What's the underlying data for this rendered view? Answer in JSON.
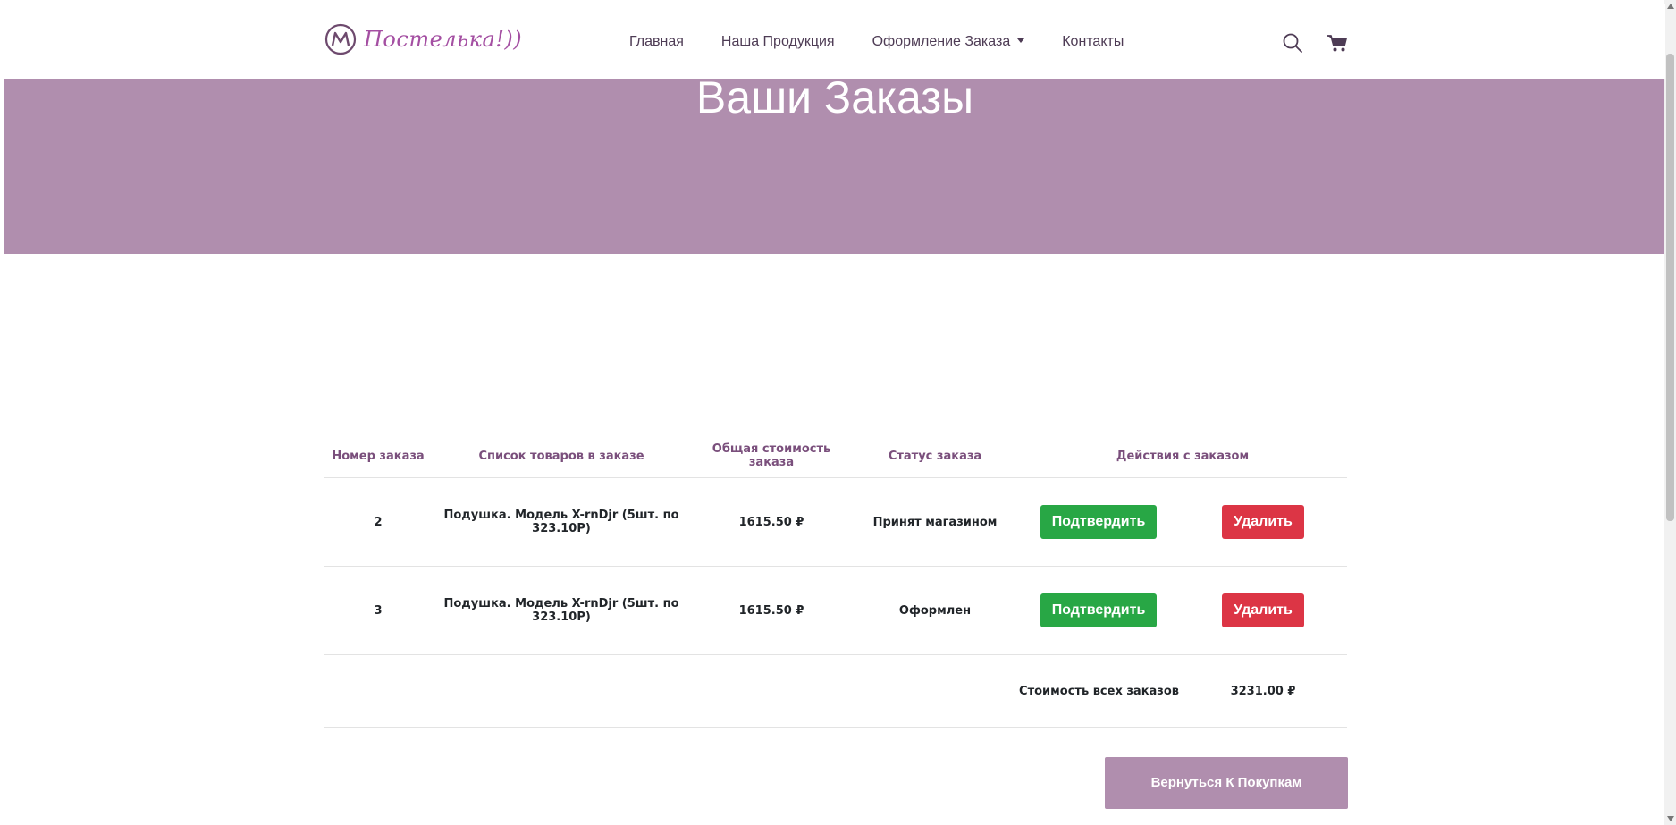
{
  "brand": {
    "name": "Постелька!))"
  },
  "nav": {
    "links": [
      {
        "label": "Главная"
      },
      {
        "label": "Наша Продукция"
      },
      {
        "label": "Оформление Заказа"
      },
      {
        "label": "Контакты"
      }
    ],
    "icons": [
      "search-icon",
      "cart-icon"
    ]
  },
  "hero": {
    "title": "Ваши Заказы"
  },
  "table": {
    "headers": [
      "Номер заказа",
      "Список товаров в заказе",
      "Общая стоимость заказа",
      "Статус заказа",
      "Действия с заказом"
    ],
    "rows": [
      {
        "number": "2",
        "items": "Подушка. Модель X-rnDjr (5шт. по 323.10Р)",
        "total": "1615.50 ₽",
        "status": "Принят магазином",
        "confirm": "Подтвердить",
        "delete": "Удалить"
      },
      {
        "number": "3",
        "items": "Подушка. Модель X-rnDjr (5шт. по 323.10Р)",
        "total": "1615.50 ₽",
        "status": "Оформлен",
        "confirm": "Подтвердить",
        "delete": "Удалить"
      }
    ],
    "summary": {
      "label": "Стоимость всех заказов",
      "value": "3231.00 ₽"
    }
  },
  "back_button": "Вернуться К Покупкам",
  "colors": {
    "accent": "#b08eae",
    "brand": "#a44fa2",
    "confirm": "#28a745",
    "delete": "#dc3545"
  }
}
